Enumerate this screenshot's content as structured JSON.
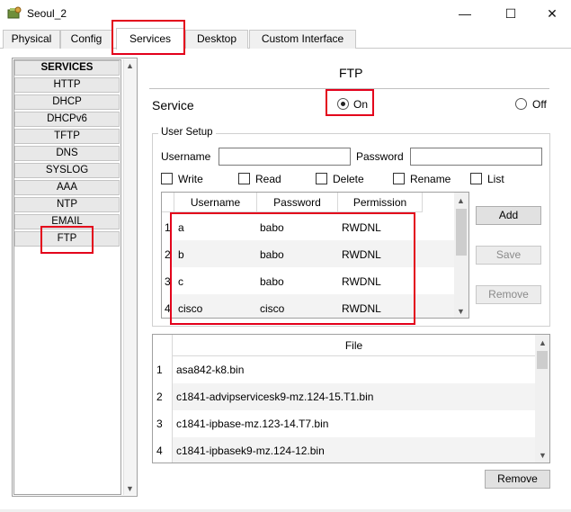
{
  "window": {
    "title": "Seoul_2",
    "minimize": "—",
    "maximize": "☐",
    "close": "✕"
  },
  "tabs": [
    {
      "label": "Physical",
      "active": false
    },
    {
      "label": "Config",
      "active": false
    },
    {
      "label": "Services",
      "active": true
    },
    {
      "label": "Desktop",
      "active": false
    },
    {
      "label": "Custom Interface",
      "active": false
    }
  ],
  "sidebar": {
    "header": "SERVICES",
    "items": [
      "HTTP",
      "DHCP",
      "DHCPv6",
      "TFTP",
      "DNS",
      "SYSLOG",
      "AAA",
      "NTP",
      "EMAIL",
      "FTP"
    ],
    "selected": "FTP"
  },
  "main": {
    "title": "FTP",
    "service_label": "Service",
    "on_label": "On",
    "off_label": "Off",
    "service_on": true
  },
  "user_setup": {
    "legend": "User Setup",
    "username_label": "Username",
    "username_value": "",
    "password_label": "Password",
    "password_value": "",
    "permissions": [
      {
        "label": "Write",
        "checked": false
      },
      {
        "label": "Read",
        "checked": false
      },
      {
        "label": "Delete",
        "checked": false
      },
      {
        "label": "Rename",
        "checked": false
      },
      {
        "label": "List",
        "checked": false
      }
    ]
  },
  "users_table": {
    "columns": [
      "Username",
      "Password",
      "Permission"
    ],
    "rows": [
      {
        "num": "1",
        "username": "a",
        "password": "babo",
        "permission": "RWDNL"
      },
      {
        "num": "2",
        "username": "b",
        "password": "babo",
        "permission": "RWDNL"
      },
      {
        "num": "3",
        "username": "c",
        "password": "babo",
        "permission": "RWDNL"
      },
      {
        "num": "4",
        "username": "cisco",
        "password": "cisco",
        "permission": "RWDNL"
      }
    ]
  },
  "user_buttons": {
    "add": "Add",
    "save": "Save",
    "remove": "Remove"
  },
  "files_table": {
    "column": "File",
    "rows": [
      {
        "num": "1",
        "name": "asa842-k8.bin"
      },
      {
        "num": "2",
        "name": "c1841-advipservicesk9-mz.124-15.T1.bin"
      },
      {
        "num": "3",
        "name": "c1841-ipbase-mz.123-14.T7.bin"
      },
      {
        "num": "4",
        "name": "c1841-ipbasek9-mz.124-12.bin"
      }
    ]
  },
  "file_buttons": {
    "remove": "Remove"
  },
  "colors": {
    "highlight": "#e3001b",
    "row_alt": "#f3f3f3"
  }
}
